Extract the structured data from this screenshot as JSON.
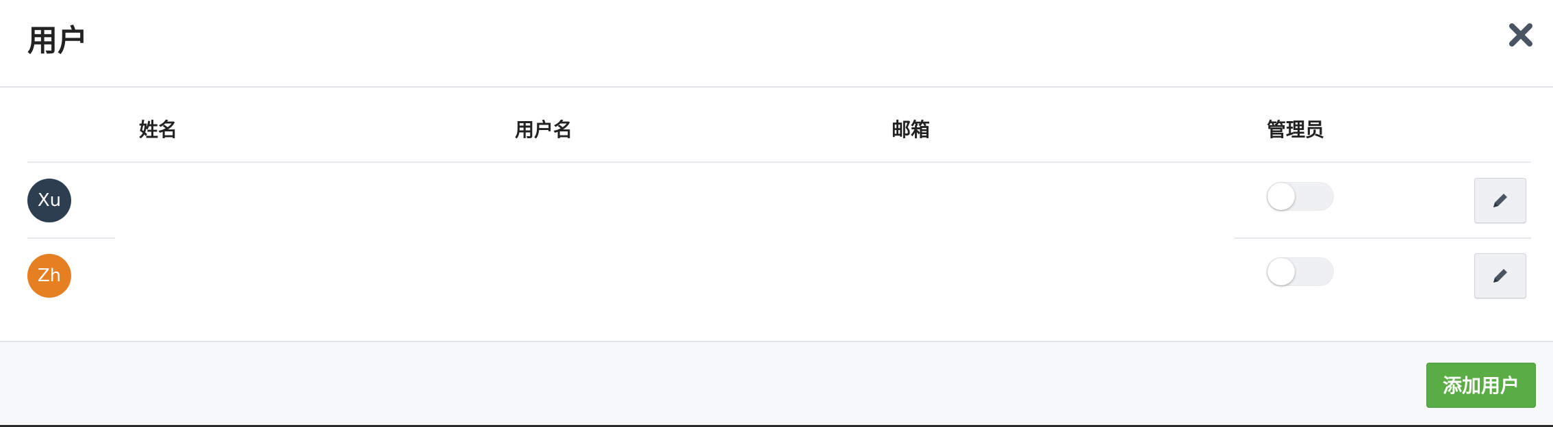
{
  "modal": {
    "title": "用户",
    "close_icon": "close-icon"
  },
  "table": {
    "columns": [
      "姓名",
      "用户名",
      "邮箱",
      "管理员"
    ],
    "rows": [
      {
        "avatar_initials": "Xu",
        "avatar_color": "#2c3e50",
        "is_admin": false,
        "edit_icon": "pencil-icon"
      },
      {
        "avatar_initials": "Zh",
        "avatar_color": "#e67e22",
        "is_admin": false,
        "edit_icon": "pencil-icon"
      }
    ]
  },
  "footer": {
    "add_user_label": "添加用户",
    "add_user_color": "#5aac44"
  },
  "colors": {
    "icon": "#4a5563",
    "border": "#dfe3e8"
  }
}
